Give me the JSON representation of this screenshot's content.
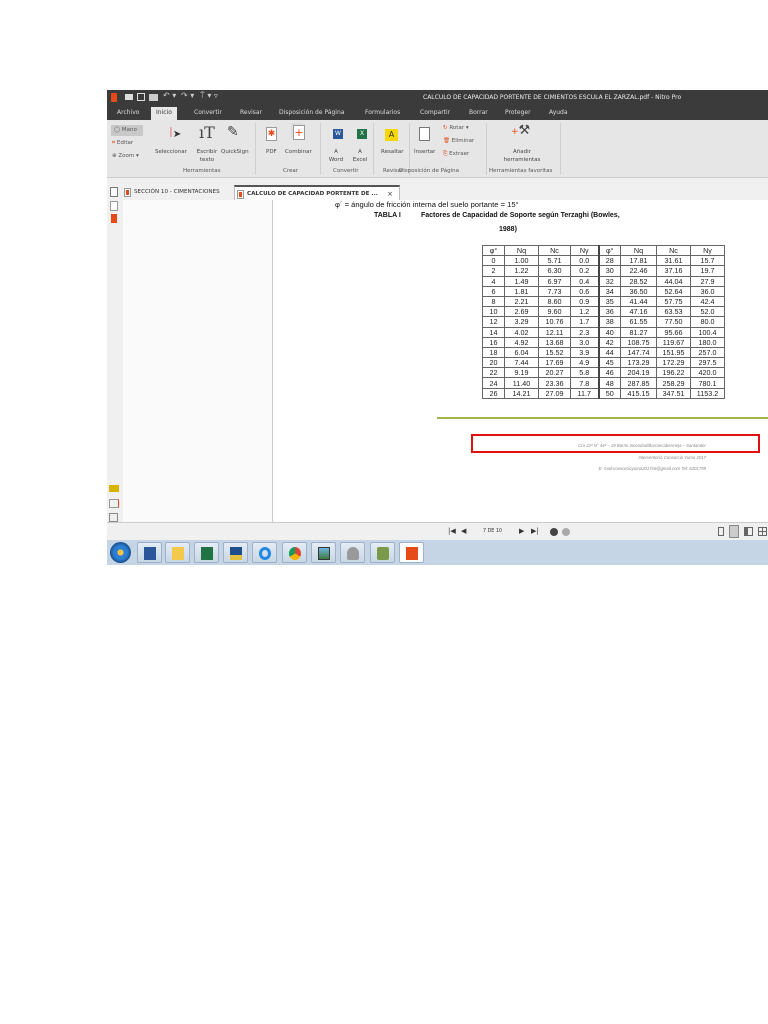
{
  "window": {
    "title": "CALCULO DE CAPACIDAD PORTENTE DE CIMIENTOS ESCULA EL ZARZAL.pdf - Nitro Pro",
    "quick_access_icons": [
      "app-logo-icon",
      "open-icon",
      "save-icon",
      "print-icon",
      "undo-icon",
      "redo-icon",
      "cursor-icon"
    ]
  },
  "menu": [
    "Archivo",
    "Inicio",
    "Convertir",
    "Revisar",
    "Disposición de Página",
    "Formularios",
    "Compartir",
    "Borrar",
    "Proteger",
    "Ayuda"
  ],
  "ribbon": {
    "mano": "Mano",
    "editar": "Editar",
    "zoom": "Zoom",
    "seleccionar": "Seleccionar",
    "escribir": "Escribir texto",
    "quicksign": "QuickSign",
    "group_herramientas": "Herramientas",
    "pdf": "PDF",
    "combinar": "Combinar",
    "group_crear": "Crear",
    "a_word": "A Word",
    "a_excel": "A Excel",
    "group_convertir": "Convertir",
    "resaltar": "Resaltar",
    "group_revisar": "Revisar",
    "insertar": "Insertar",
    "rotar": "Rotar",
    "eliminar": "Eliminar",
    "extraer": "Extraer",
    "group_disposicion": "Disposición de Página",
    "anadir": "Añadir herramientas",
    "group_favoritas": "Herramientas favoritas"
  },
  "tabs": [
    {
      "label": "SECCIÓN 10 - CIMENTACIONES",
      "active": false
    },
    {
      "label": "CALCULO DE CAPACIDAD PORTENTE DE ...",
      "active": true,
      "close": "×"
    }
  ],
  "document": {
    "phi_line": "φ´ = ángulo de fricción interna del suelo portante = 15°",
    "table_label": "TABLA I",
    "table_title_1": "Factores de Capacidad de Soporte según Terzaghi (Bowles,",
    "table_title_2": "1988)",
    "table": {
      "headers": [
        "φ°",
        "Nq",
        "Nc",
        "Nγ",
        "φ°",
        "Nq",
        "Nc",
        "Nγ"
      ],
      "rows": [
        [
          "0",
          "1.00",
          "5.71",
          "0.0",
          "28",
          "17.81",
          "31.61",
          "15.7"
        ],
        [
          "2",
          "1.22",
          "6.30",
          "0.2",
          "30",
          "22.46",
          "37.16",
          "19.7"
        ],
        [
          "4",
          "1.49",
          "6.97",
          "0.4",
          "32",
          "28.52",
          "44.04",
          "27.9"
        ],
        [
          "6",
          "1.81",
          "7.73",
          "0.6",
          "34",
          "36.50",
          "52.64",
          "36.0"
        ],
        [
          "8",
          "2.21",
          "8.60",
          "0.9",
          "35",
          "41.44",
          "57.75",
          "42.4"
        ],
        [
          "10",
          "2.69",
          "9.60",
          "1.2",
          "36",
          "47.16",
          "63.53",
          "52.0"
        ],
        [
          "12",
          "3.29",
          "10.76",
          "1.7",
          "38",
          "61.55",
          "77.50",
          "80.0"
        ],
        [
          "14",
          "4.02",
          "12.11",
          "2.3",
          "40",
          "81.27",
          "95.66",
          "100.4"
        ],
        [
          "16",
          "4.92",
          "13.68",
          "3.0",
          "42",
          "108.75",
          "119.67",
          "180.0"
        ],
        [
          "18",
          "6.04",
          "15.52",
          "3.9",
          "44",
          "147.74",
          "151.95",
          "257.0"
        ],
        [
          "20",
          "7.44",
          "17.69",
          "4.9",
          "45",
          "173.29",
          "172.29",
          "297.5"
        ],
        [
          "22",
          "9.19",
          "20.27",
          "5.8",
          "46",
          "204.19",
          "196.22",
          "420.0"
        ],
        [
          "24",
          "11.40",
          "23.36",
          "7.8",
          "48",
          "287.85",
          "258.29",
          "780.1"
        ],
        [
          "26",
          "14.21",
          "27.09",
          "11.7",
          "50",
          "415.15",
          "347.51",
          "1153.2"
        ]
      ],
      "highlighted_rows": [
        "14",
        "16"
      ],
      "highlight_color": "#e01010"
    },
    "footer": [
      "Cra 22ª N° 44ª – 19 Barrio Inocedad/Barrancabermeja – Santander",
      "Interventoría Consorcio Yuma 2017",
      "E- mail:consorcioyuma2017int@gmail.com   Tel: 6201799"
    ],
    "footer_line_color": "#a3b54a"
  },
  "navigation": {
    "page_indicator": "7 DE 10"
  },
  "taskbar": [
    "start",
    "word",
    "file-explorer",
    "excel",
    "dwg",
    "internet-explorer",
    "chrome",
    "image-viewer",
    "app",
    "app-green",
    "nitro-pro"
  ]
}
